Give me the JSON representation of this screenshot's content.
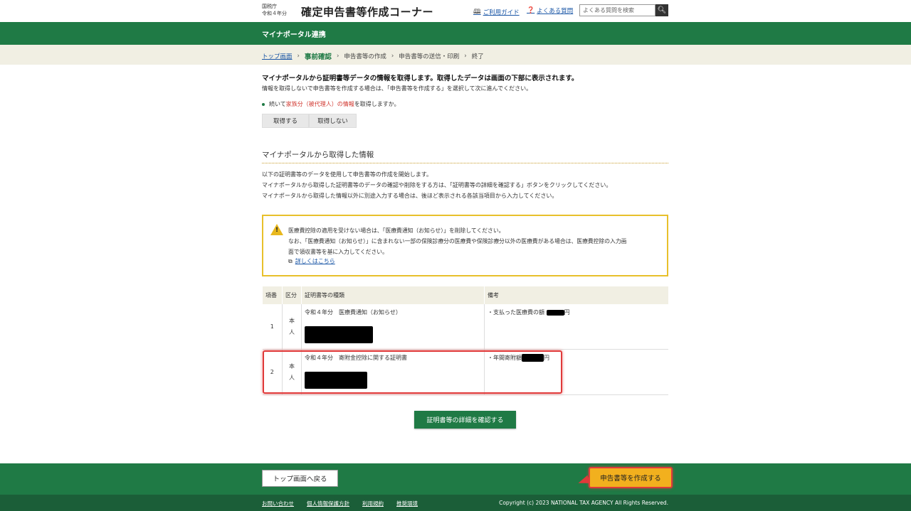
{
  "header": {
    "agency_line1": "国税庁",
    "agency_line2": "令和４年分",
    "site_title": "確定申告書等作成コーナー",
    "guide_link": "ご利用ガイド",
    "faq_link": "よくある質問",
    "search_placeholder": "よくある質問を検索"
  },
  "section_bar": {
    "title": "マイナポータル連携"
  },
  "breadcrumb": {
    "items": [
      "トップ画面",
      "事前確認",
      "申告書等の作成",
      "申告書等の送信・印刷",
      "終了"
    ]
  },
  "main": {
    "lead": "マイナポータルから証明書等データの情報を取得します。取得したデータは画面の下部に表示されます。",
    "sub_lead": "情報を取得しないで申告書等を作成する場合は、「申告書等を作成する」を選択して次に進んでください。",
    "family_q_pre": "続いて",
    "family_q_red": "家族分（被代理人）の情報",
    "family_q_post": "を取得しますか。",
    "get_label": "取得する",
    "no_get_label": "取得しない",
    "section_title": "マイナポータルから取得した情報",
    "info_lines": [
      "以下の証明書等のデータを使用して申告書等の作成を開始します。",
      "マイナポータルから取得した証明書等のデータの確認や削除をする方は、「証明書等の詳細を確認する」ボタンをクリックしてください。",
      "マイナポータルから取得した情報以外に別途入力する場合は、後ほど表示される各該当項目から入力してください。"
    ],
    "alert": {
      "lines": [
        "医療費控除の適用を受けない場合は、「医療費通知（お知らせ）」を削除してください。",
        "なお、「医療費通知（お知らせ）」に含まれない一部の保険診療分の医療費や保険診療分以外の医療費がある場合は、医療費控除の入力画",
        "面で領収書等を基に入力してください。"
      ],
      "link": "詳しくはこちら"
    },
    "table": {
      "headers": [
        "項番",
        "区分",
        "証明書等の種類",
        "備考"
      ],
      "rows": [
        {
          "no": "1",
          "kbn1": "本",
          "kbn2": "人",
          "type": "令和４年分　医療費通知（お知らせ）",
          "note_pre": "・支払った医療費の額",
          "note_post": "円"
        },
        {
          "no": "2",
          "kbn1": "本",
          "kbn2": "人",
          "type": "令和４年分　寄附金控除に関する証明書",
          "note_pre": "・年間寄附額",
          "note_post": "円"
        }
      ]
    },
    "detail_button": "証明書等の詳細を確認する"
  },
  "footer": {
    "back_button": "トップ画面へ戻る",
    "create_button": "申告書等を作成する",
    "links": [
      "お問い合わせ",
      "個人情報保護方針",
      "利用規約",
      "推奨環境"
    ],
    "copyright": "Copyright (c) 2023 NATIONAL TAX AGENCY All Rights Reserved."
  }
}
